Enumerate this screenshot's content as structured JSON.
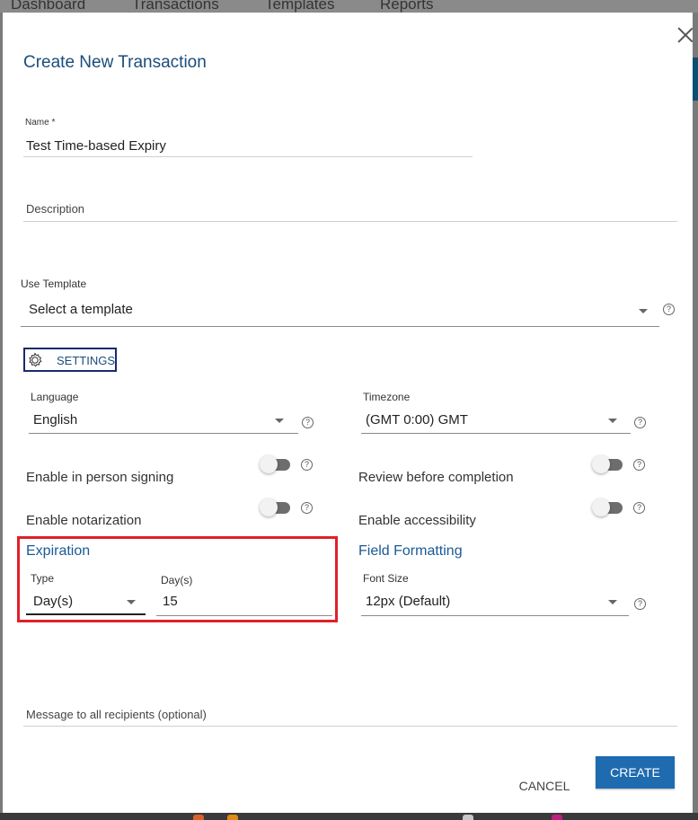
{
  "background_nav": [
    "Dashboard",
    "Transactions",
    "Templates",
    "Reports"
  ],
  "dialog": {
    "title": "Create New Transaction",
    "name": {
      "label": "Name *",
      "value": "Test Time-based Expiry"
    },
    "description": {
      "placeholder": "Description"
    },
    "template": {
      "label": "Use Template",
      "value": "Select a template"
    },
    "settings_button": "SETTINGS",
    "language": {
      "label": "Language",
      "value": "English"
    },
    "timezone": {
      "label": "Timezone",
      "value": "(GMT 0:00) GMT"
    },
    "toggles": {
      "in_person": {
        "label": "Enable in person signing",
        "on": false
      },
      "review": {
        "label": "Review before completion",
        "on": false
      },
      "notarization": {
        "label": "Enable notarization",
        "on": false
      },
      "accessibility": {
        "label": "Enable accessibility",
        "on": false
      }
    },
    "expiration": {
      "heading": "Expiration",
      "type_label": "Type",
      "type_value": "Day(s)",
      "days_label": "Day(s)",
      "days_value": "15"
    },
    "field_formatting": {
      "heading": "Field Formatting",
      "font_size_label": "Font Size",
      "font_size_value": "12px (Default)"
    },
    "message": {
      "placeholder": "Message to all recipients (optional)"
    },
    "cancel_button": "CANCEL",
    "create_button": "CREATE",
    "help_glyph": "?"
  },
  "colors": {
    "accent": "#1e6bb0",
    "title": "#1a4d7a",
    "highlight": "#e0202a"
  }
}
